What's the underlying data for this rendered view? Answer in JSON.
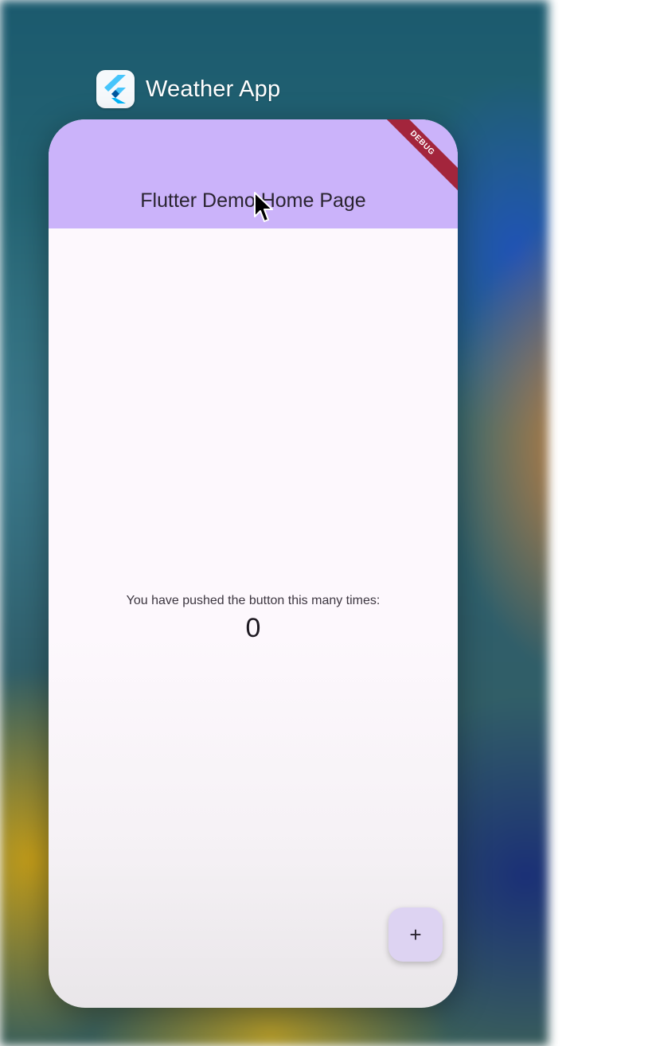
{
  "switcher": {
    "app_name": "Weather App",
    "app_icon": "flutter-logo-icon"
  },
  "app": {
    "title": "Flutter Demo Home Page",
    "debug_banner": "DEBUG",
    "counter_label": "You have pushed the button this many times:",
    "counter_value": "0",
    "fab_label": "+",
    "fab_icon": "add-icon"
  },
  "colors": {
    "appbar": "#cbb3fa",
    "surface": "#fdf8fd",
    "fab": "#ddd3f2",
    "debug_banner": "#a3253c"
  }
}
